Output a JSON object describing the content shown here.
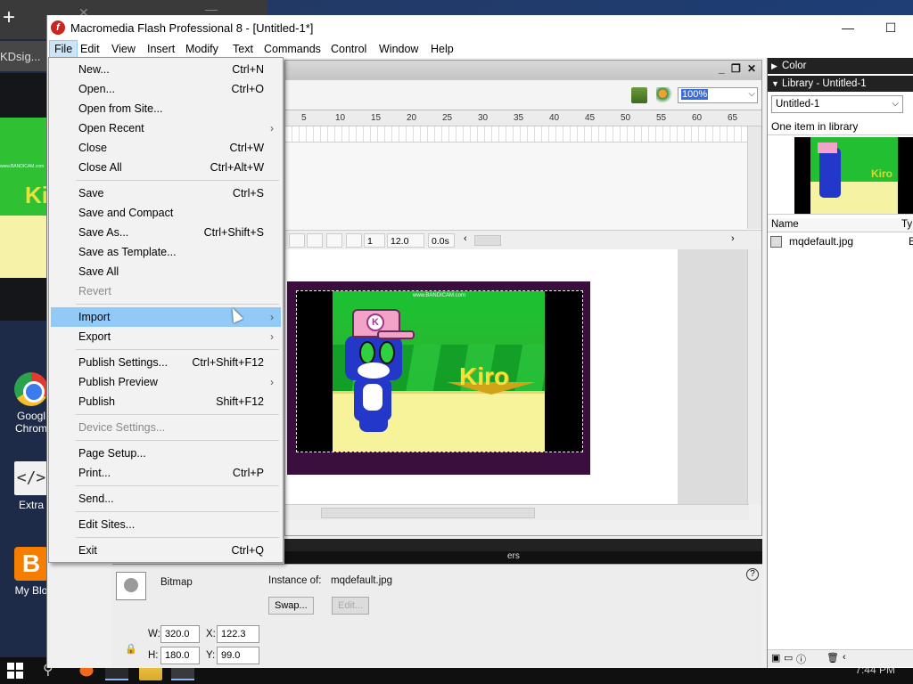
{
  "desktop": {
    "tab_label": "KDsig...",
    "icons": [
      {
        "label_line1": "Googl",
        "label_line2": "Chrom"
      },
      {
        "label_line1": "Extra",
        "label_line2": ""
      },
      {
        "label_line1": "My Blo",
        "label_line2": ""
      }
    ],
    "bandicam_text": "www.BANDICAM.com",
    "taskbar_clock": "7:44 PM"
  },
  "window": {
    "title": "Macromedia Flash Professional 8 - [Untitled-1*]",
    "minimize": "—",
    "maximize": "☐"
  },
  "menubar": {
    "items": [
      "File",
      "Edit",
      "View",
      "Insert",
      "Modify",
      "Text",
      "Commands",
      "Control",
      "Window",
      "Help"
    ]
  },
  "file_menu": {
    "items": [
      {
        "label": "New...",
        "shortcut": "Ctrl+N"
      },
      {
        "label": "Open...",
        "shortcut": "Ctrl+O"
      },
      {
        "label": "Open from Site...",
        "shortcut": ""
      },
      {
        "label": "Open Recent",
        "shortcut": "",
        "submenu": "›"
      },
      {
        "label": "Close",
        "shortcut": "Ctrl+W"
      },
      {
        "label": "Close All",
        "shortcut": "Ctrl+Alt+W"
      },
      {
        "label": "Save",
        "shortcut": "Ctrl+S"
      },
      {
        "label": "Save and Compact",
        "shortcut": ""
      },
      {
        "label": "Save As...",
        "shortcut": "Ctrl+Shift+S"
      },
      {
        "label": "Save as Template...",
        "shortcut": ""
      },
      {
        "label": "Save All",
        "shortcut": ""
      },
      {
        "label": "Revert",
        "shortcut": ""
      },
      {
        "label": "Import",
        "shortcut": "",
        "submenu": "›"
      },
      {
        "label": "Export",
        "shortcut": "",
        "submenu": "›"
      },
      {
        "label": "Publish Settings...",
        "shortcut": "Ctrl+Shift+F12"
      },
      {
        "label": "Publish Preview",
        "shortcut": "",
        "submenu": "›"
      },
      {
        "label": "Publish",
        "shortcut": "Shift+F12"
      },
      {
        "label": "Device Settings...",
        "shortcut": ""
      },
      {
        "label": "Page Setup...",
        "shortcut": ""
      },
      {
        "label": "Print...",
        "shortcut": "Ctrl+P"
      },
      {
        "label": "Send...",
        "shortcut": ""
      },
      {
        "label": "Edit Sites...",
        "shortcut": ""
      },
      {
        "label": "Exit",
        "shortcut": "Ctrl+Q"
      }
    ]
  },
  "document": {
    "zoom": "100%",
    "ruler_ticks": [
      "5",
      "10",
      "15",
      "20",
      "25",
      "30",
      "35",
      "40",
      "45",
      "50",
      "55",
      "60",
      "65"
    ],
    "current_frame": "1",
    "frame_rate": "12.0 fps",
    "elapsed": "0.0s",
    "stage_text": "Kiro"
  },
  "properties": {
    "type": "Bitmap",
    "instance_label": "Instance of:",
    "instance_value": "mqdefault.jpg",
    "swap_button": "Swap...",
    "edit_button": "Edit...",
    "w_label": "W:",
    "w_value": "320.0",
    "h_label": "H:",
    "h_value": "180.0",
    "x_label": "X:",
    "x_value": "122.3",
    "y_label": "Y:",
    "y_value": "99.0",
    "tab_fragment": "ers"
  },
  "right_panel": {
    "color_header": "Color",
    "library_header": "Library - Untitled-1",
    "library_select": "Untitled-1",
    "item_count": "One item in library",
    "col_name": "Name",
    "col_type": "Ty",
    "item_name": "mqdefault.jpg",
    "item_type": "E",
    "preview_text": "Kiro"
  }
}
